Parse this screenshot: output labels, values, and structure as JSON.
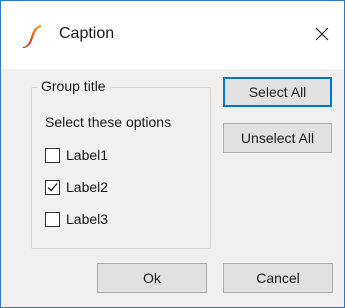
{
  "window": {
    "title": "Caption",
    "app_icon": "swoosh-logo-icon",
    "close_icon": "close-icon"
  },
  "group": {
    "title": "Group title",
    "hint": "Select these options",
    "options": [
      {
        "label": "Label1",
        "checked": false
      },
      {
        "label": "Label2",
        "checked": true
      },
      {
        "label": "Label3",
        "checked": false
      }
    ]
  },
  "buttons": {
    "select_all": "Select All",
    "unselect_all": "Unselect All",
    "ok": "Ok",
    "cancel": "Cancel"
  },
  "colors": {
    "window_border": "#2b79c8",
    "focus_border": "#0078d7",
    "icon_gradient_top": "#f7a21b",
    "icon_gradient_bottom": "#d7191c"
  }
}
